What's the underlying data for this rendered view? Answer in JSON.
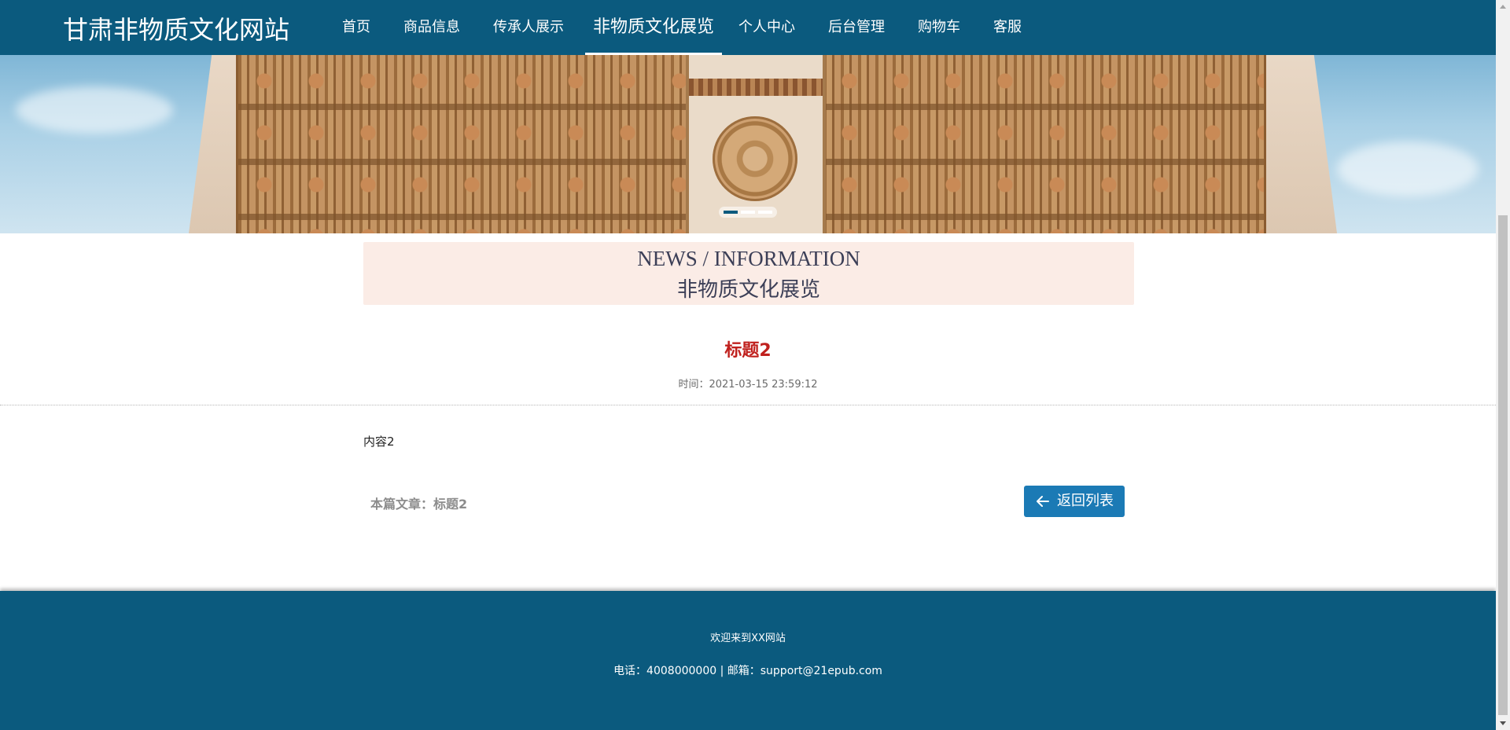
{
  "header": {
    "site_title": "甘肃非物质文化网站",
    "nav": [
      {
        "label": "首页"
      },
      {
        "label": "商品信息"
      },
      {
        "label": "传承人展示"
      },
      {
        "label": "非物质文化展览",
        "active": true
      },
      {
        "label": "个人中心"
      },
      {
        "label": "后台管理"
      },
      {
        "label": "购物车"
      },
      {
        "label": "客服"
      }
    ]
  },
  "banner": {
    "slide_count": 3,
    "active_slide": 1
  },
  "section": {
    "title_en": "NEWS / INFORMATION",
    "title_cn": "非物质文化展览"
  },
  "article": {
    "title": "标题2",
    "time": "时间：2021-03-15 23:59:12",
    "content": "内容2",
    "this_article": "本篇文章：标题2",
    "back_button": "返回列表"
  },
  "footer": {
    "welcome": "欢迎来到XX网站",
    "contact": "电话：4008000000 | 邮箱：support@21epub.com"
  },
  "colors": {
    "header_bg": "#0b5a7e",
    "accent_button": "#1b7ab5",
    "article_title": "#c0211e",
    "section_head_bg": "#fbece6"
  }
}
